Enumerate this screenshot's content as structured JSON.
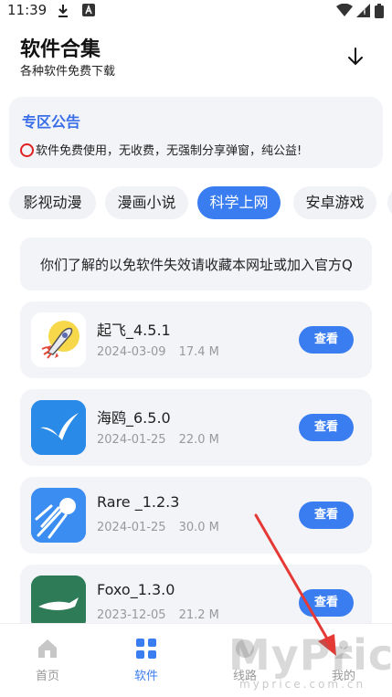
{
  "status_bar": {
    "time": "11:39",
    "icons": [
      "download-icon",
      "notification-app-icon",
      "wifi-icon",
      "signal-icon",
      "battery-icon"
    ]
  },
  "header": {
    "title": "软件合集",
    "subtitle": "各种软件免费下载",
    "action_icon": "download-arrow-icon"
  },
  "notice": {
    "title": "专区公告",
    "text": "软件免费使用，无收费，无强制分享弹窗，纯公益!"
  },
  "categories": [
    {
      "label": "影视动漫",
      "active": false
    },
    {
      "label": "漫画小说",
      "active": false
    },
    {
      "label": "科学上网",
      "active": true
    },
    {
      "label": "安卓游戏",
      "active": false
    }
  ],
  "marquee": {
    "text": "你们了解的以免软件失效请收藏本网址或加入官方Q"
  },
  "apps": [
    {
      "name": "起飞_4.5.1",
      "date": "2024-03-09",
      "size": "17.4 M",
      "action": "查看",
      "icon": "rocket-icon"
    },
    {
      "name": "海鸥_6.5.0",
      "date": "2024-01-25",
      "size": "22.0 M",
      "action": "查看",
      "icon": "seagull-icon"
    },
    {
      "name": "Rare _1.2.3",
      "date": "2024-01-25",
      "size": "30.0 M",
      "action": "查看",
      "icon": "comet-icon"
    },
    {
      "name": "Foxo_1.3.0",
      "date": "2023-12-05",
      "size": "21.2 M",
      "action": "查看",
      "icon": "fox-icon"
    }
  ],
  "bottom_nav": [
    {
      "label": "首页",
      "icon": "home-icon",
      "active": false
    },
    {
      "label": "软件",
      "icon": "grid-icon",
      "active": true
    },
    {
      "label": "线路",
      "icon": "route-icon",
      "active": false
    },
    {
      "label": "我的",
      "icon": "profile-icon",
      "active": false
    }
  ],
  "watermark": {
    "text": "MyPrice",
    "sub": "myprice.com.cn"
  },
  "colors": {
    "accent": "#3a7df0",
    "notice_title": "#3a6ee8",
    "card_bg": "#f3f4f8",
    "annotation_arrow": "#e53935"
  }
}
